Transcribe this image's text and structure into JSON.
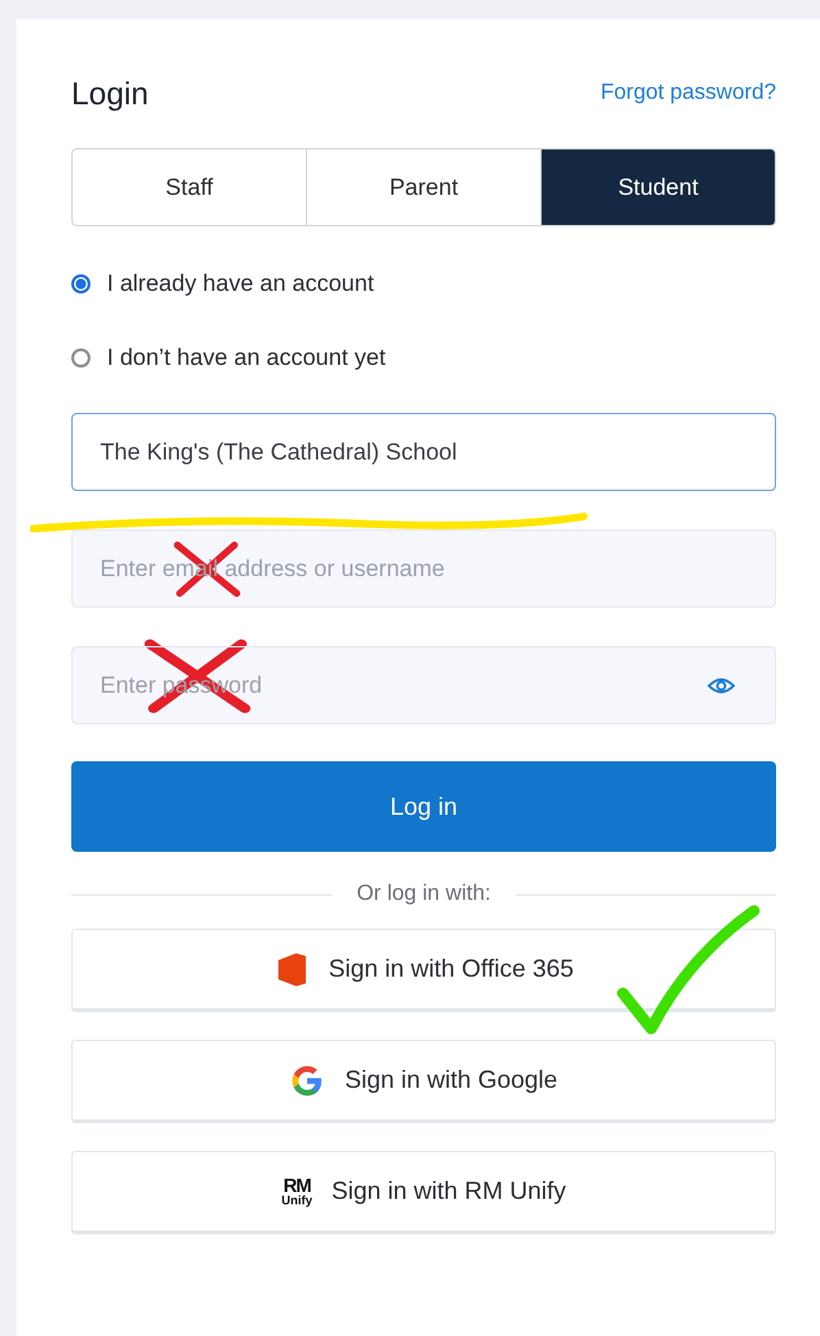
{
  "title": "Login",
  "forgot_link": "Forgot password?",
  "tabs": [
    {
      "label": "Staff",
      "selected": false
    },
    {
      "label": "Parent",
      "selected": false
    },
    {
      "label": "Student",
      "selected": true
    }
  ],
  "account_options": [
    {
      "label": "I already have an account",
      "selected": true
    },
    {
      "label": "I don’t have an account yet",
      "selected": false
    }
  ],
  "school_field": {
    "value": "The King's (The Cathedral) School",
    "focused": true
  },
  "username_field": {
    "placeholder": "Enter email address or username"
  },
  "password_field": {
    "placeholder": "Enter password"
  },
  "login_button": "Log in",
  "divider_text": "Or log in with:",
  "sign_in_options": [
    {
      "kind": "office",
      "label": "Sign in with Office 365"
    },
    {
      "kind": "google",
      "label": "Sign in with Google"
    },
    {
      "kind": "rmunify",
      "label": "Sign in with RM Unify",
      "logo_lines": [
        "RM",
        "Unify"
      ]
    }
  ],
  "annotations": [
    {
      "kind": "underline"
    },
    {
      "kind": "cross"
    },
    {
      "kind": "cross"
    },
    {
      "kind": "check"
    }
  ]
}
